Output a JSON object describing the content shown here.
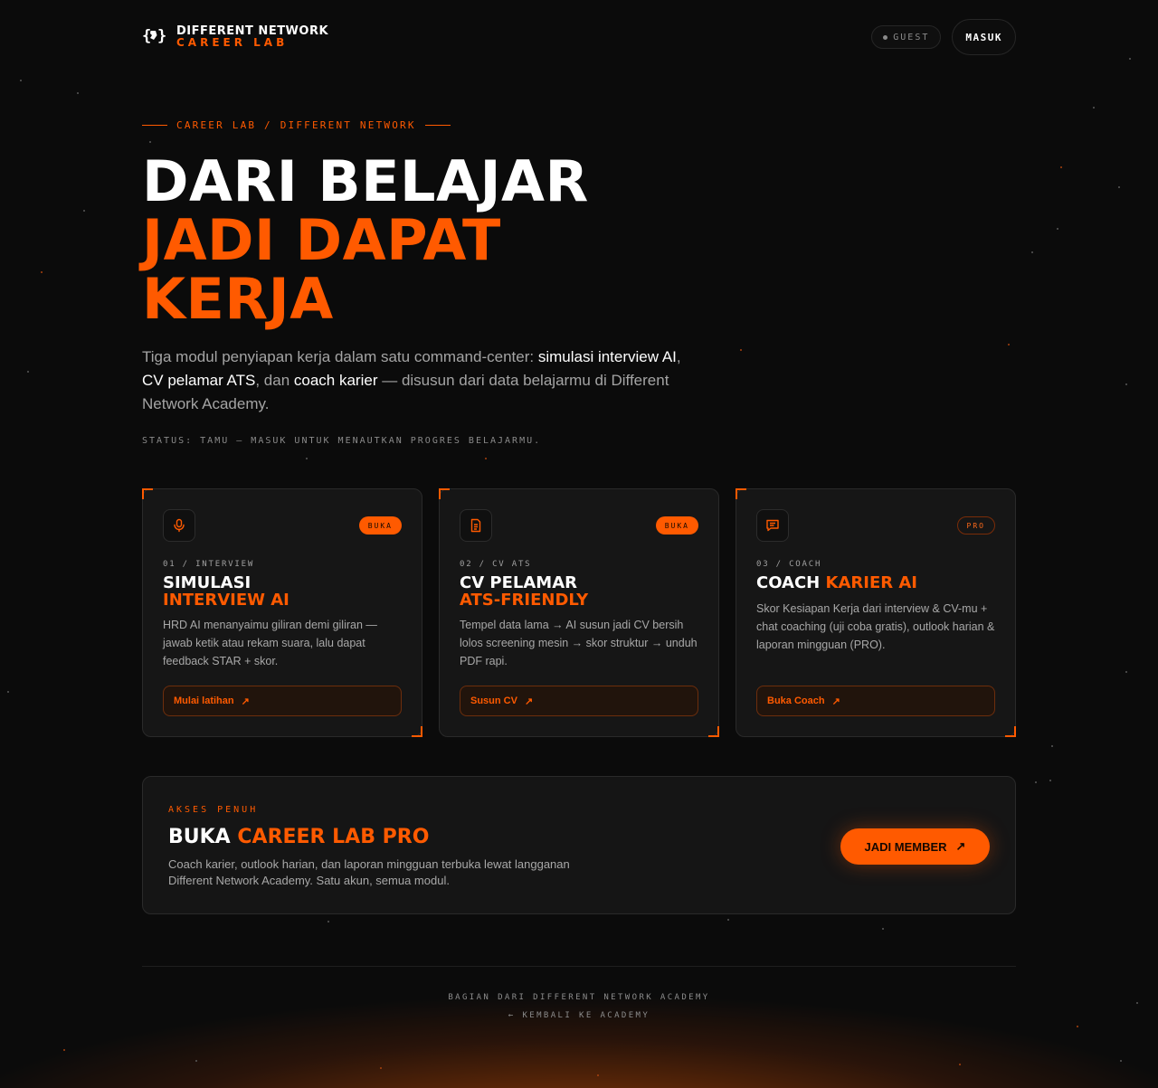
{
  "header": {
    "logo_glyph": "{ↄ}",
    "brand_line1": "DIFFERENT NETWORK",
    "brand_line2": "CAREER LAB",
    "guest_label": "GUEST",
    "login_label": "MASUK"
  },
  "hero": {
    "eyebrow": "CAREER LAB / DIFFERENT NETWORK",
    "title_line1": "DARI BELAJAR",
    "title_line2": "JADI DAPAT",
    "title_line3": "KERJA",
    "desc_part1": "Tiga modul penyiapan kerja dalam satu command-center: ",
    "desc_em1": "simulasi interview AI",
    "desc_part2": ", ",
    "desc_em2": "CV pelamar ATS",
    "desc_part3": ", dan ",
    "desc_em3": "coach karier",
    "desc_part4": " — disusun dari data belajarmu di Different Network Academy.",
    "status": "STATUS: TAMU — MASUK UNTUK MENAUTKAN PROGRES BELAJARMU."
  },
  "cards": [
    {
      "icon": "microphone-icon",
      "badge": "BUKA",
      "kicker": "01 / INTERVIEW",
      "title_white": "SIMULASI",
      "title_orange": "INTERVIEW AI",
      "desc": "HRD AI menanyaimu giliran demi giliran — jawab ketik atau rekam suara, lalu dapat feedback STAR + skor.",
      "button": "Mulai latihan"
    },
    {
      "icon": "document-icon",
      "badge": "BUKA",
      "kicker": "02 / CV ATS",
      "title_white": "CV PELAMAR",
      "title_orange": "ATS-FRIENDLY",
      "desc": "Tempel data lama → AI susun jadi CV bersih lolos screening mesin → skor struktur → unduh PDF rapi.",
      "button": "Susun CV"
    },
    {
      "icon": "chat-icon",
      "badge": "PRO",
      "kicker": "03 / COACH",
      "title_white": "COACH",
      "title_orange": "KARIER AI",
      "desc": "Skor Kesiapan Kerja dari interview & CV-mu + chat coaching (uji coba gratis), outlook harian & laporan mingguan (PRO).",
      "button": "Buka Coach"
    }
  ],
  "pro": {
    "kicker": "AKSES PENUH",
    "title_white": "BUKA",
    "title_orange": "CAREER LAB PRO",
    "desc": "Coach karier, outlook harian, dan laporan mingguan terbuka lewat langganan Different Network Academy. Satu akun, semua modul.",
    "button": "JADI MEMBER"
  },
  "footer": {
    "line1": "BAGIAN DARI DIFFERENT NETWORK ACADEMY",
    "line2": "← KEMBALI KE ACADEMY"
  },
  "colors": {
    "accent": "#ff5a00",
    "background": "#0b0b0b",
    "card": "#161616"
  }
}
